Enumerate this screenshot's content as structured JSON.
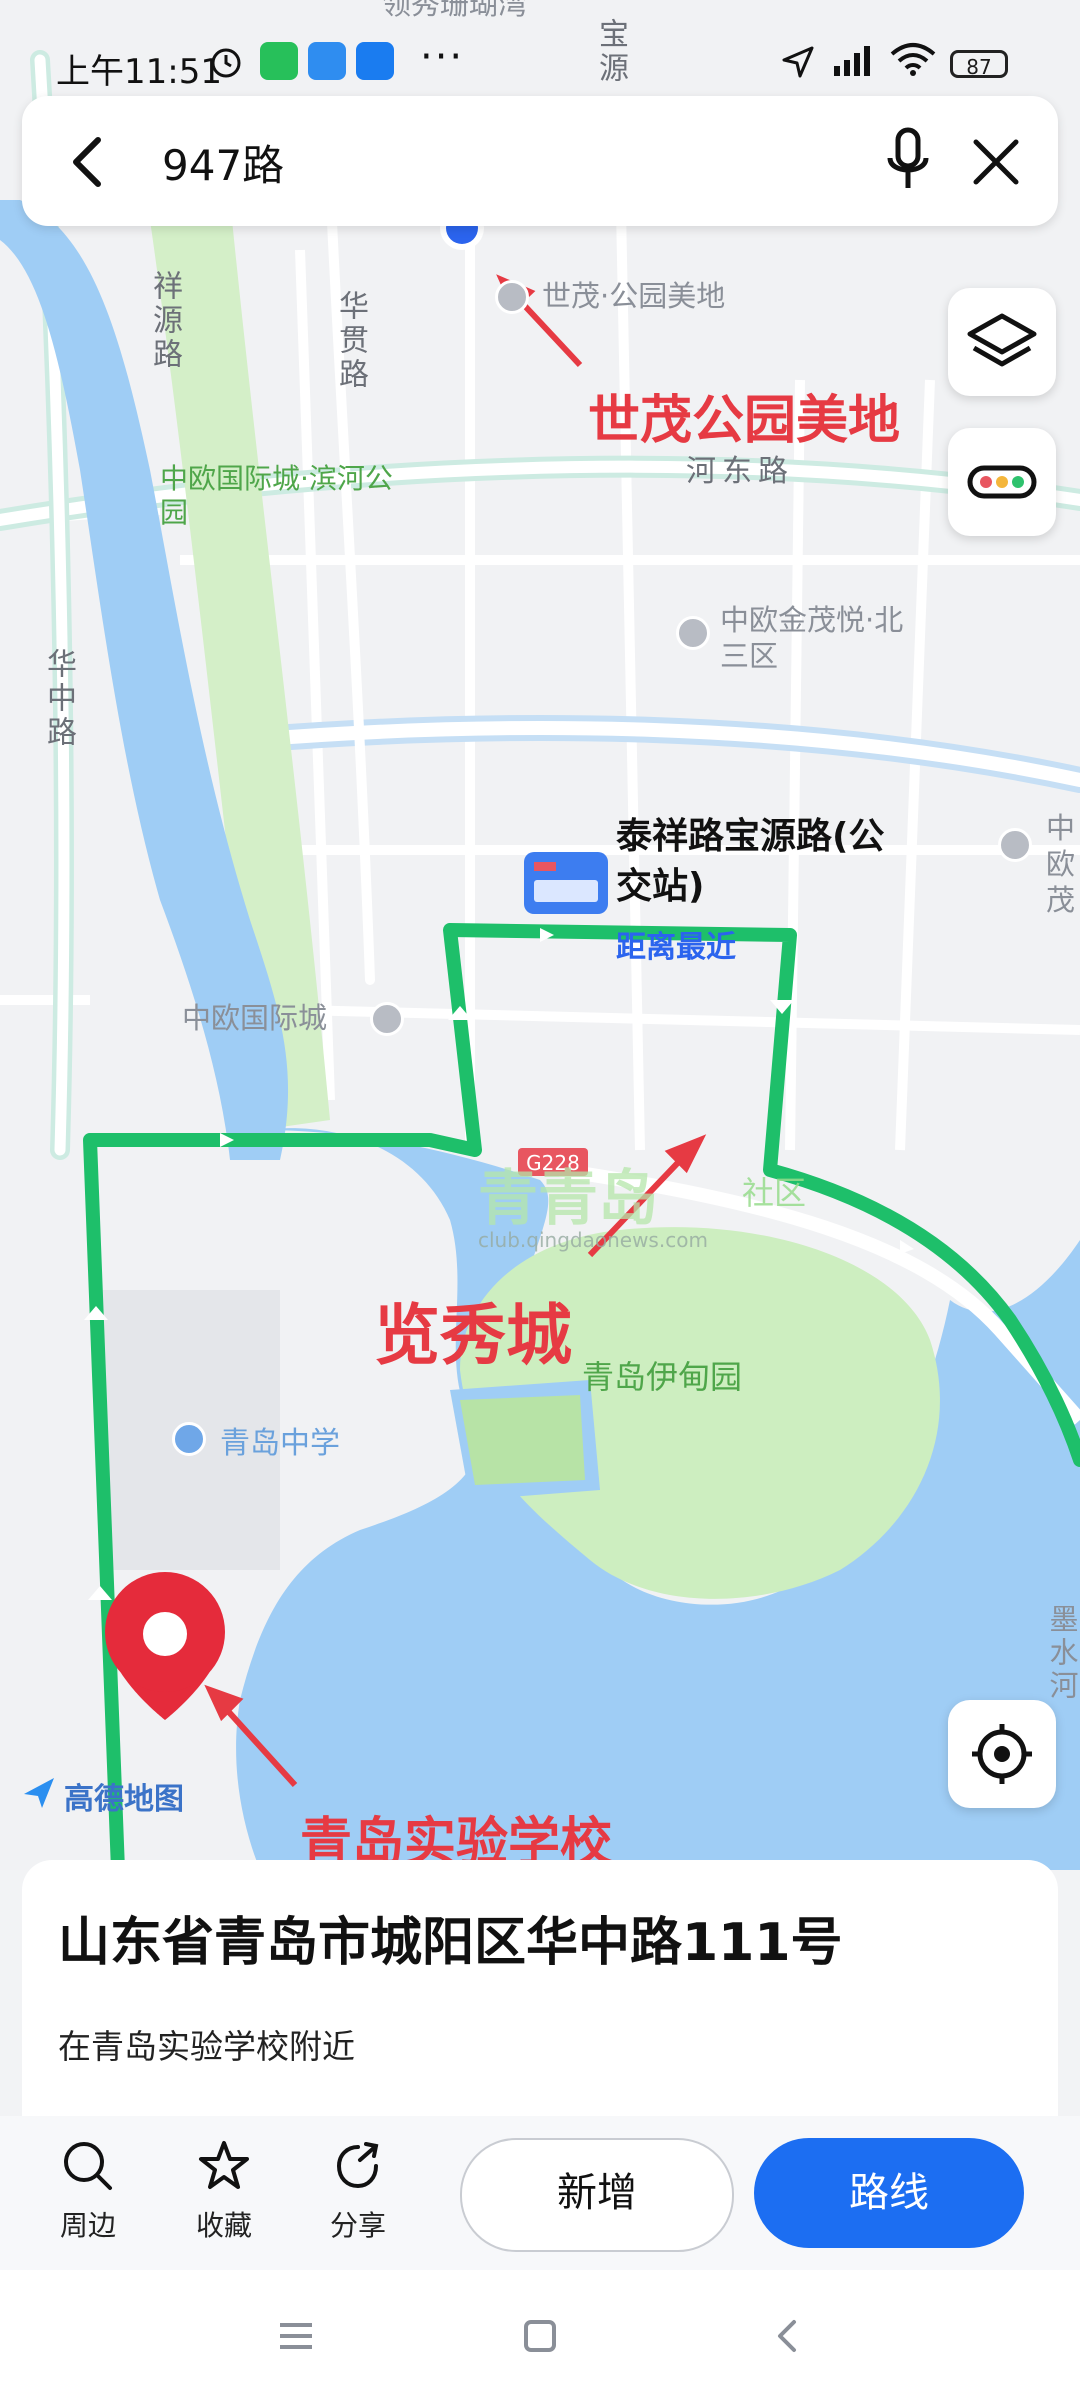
{
  "status_bar": {
    "time": "上午11:51",
    "battery": "87"
  },
  "search": {
    "query": "947路"
  },
  "map": {
    "roads": [
      "祥源路",
      "华贯路",
      "华中路",
      "河东路",
      "宝源"
    ],
    "road_badge": "G228",
    "places": [
      "世茂·公园美地",
      "中欧国际城·滨河公园",
      "中欧金茂悦·北三区",
      "中欧国际城",
      "青岛中学",
      "青岛伊甸园",
      "领秀珊瑚湾",
      "中欧茂",
      "墨水河"
    ],
    "bus_stop": {
      "name": "泰祥路宝源路(公交站)",
      "tag": "距离最近"
    },
    "annotations": [
      "世茂公园美地",
      "览秀城",
      "青岛实验学校"
    ],
    "watermark": {
      "brand": "青青岛",
      "suffix": "社区",
      "url": "club.qingdaonews.com"
    },
    "logo": "高德地图"
  },
  "sheet": {
    "address": "山东省青岛市城阳区华中路111号",
    "nearby": "在青岛实验学校附近"
  },
  "actions": {
    "nearby": "周边",
    "favorite": "收藏",
    "share": "分享",
    "add": "新增",
    "route": "路线"
  }
}
